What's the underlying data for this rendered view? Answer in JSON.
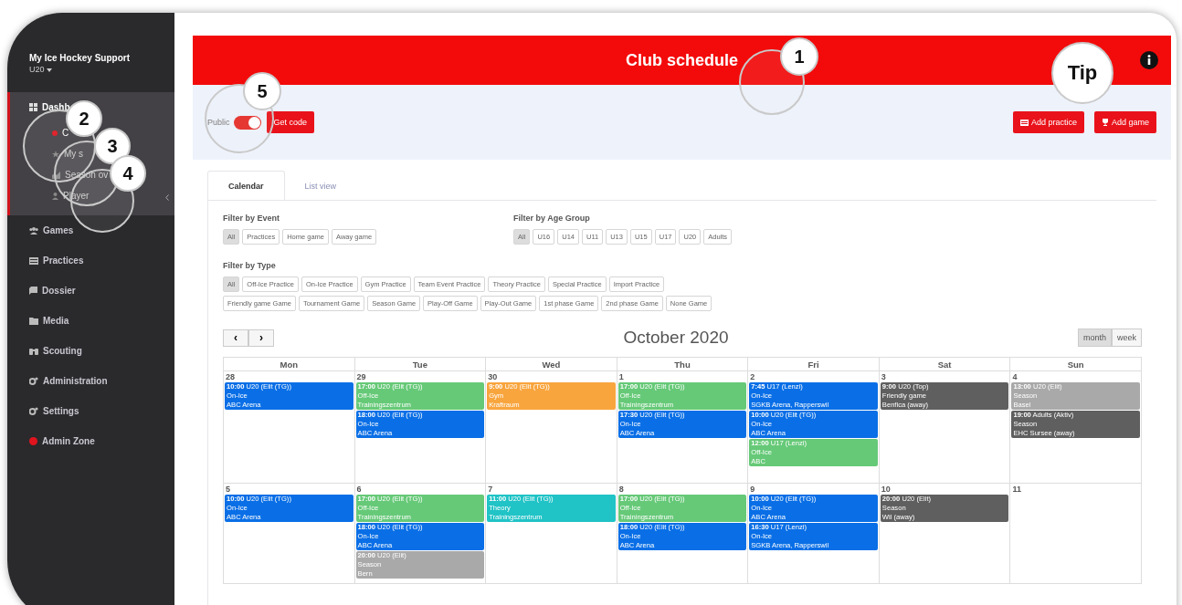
{
  "sidebar": {
    "app_name": "My Ice Hockey Support",
    "team": "U20",
    "items": [
      {
        "label": "Dashb",
        "expanded": true,
        "children": [
          {
            "label": "C",
            "selected": true
          },
          {
            "label": "My s",
            "selected": false
          },
          {
            "label": "Season ov",
            "selected": false
          },
          {
            "label": "Player",
            "selected": false
          }
        ]
      },
      {
        "label": "Games",
        "expanded": false
      },
      {
        "label": "Practices",
        "expanded": false
      },
      {
        "label": "Dossier",
        "expanded": false
      },
      {
        "label": "Media",
        "expanded": false
      },
      {
        "label": "Scouting",
        "expanded": false
      },
      {
        "label": "Administration",
        "expanded": false
      },
      {
        "label": "Settings",
        "expanded": false
      },
      {
        "label": "Admin Zone",
        "expanded": false
      }
    ]
  },
  "header": {
    "title": "Club schedule"
  },
  "toolbar": {
    "public": {
      "label": "Public",
      "on": true
    },
    "get_code": "Get code",
    "buttons": [
      "Add practice",
      "Add game"
    ]
  },
  "tabs": [
    {
      "label": "Calendar",
      "selected": true
    },
    {
      "label": "List view",
      "selected": false
    }
  ],
  "filters": [
    {
      "title": "Filter by Event",
      "rows": [
        {
          "chips": [
            {
              "label": "All",
              "selected": true
            },
            {
              "label": "Practices",
              "selected": false
            },
            {
              "label": "Home game",
              "selected": false
            },
            {
              "label": "Away game",
              "selected": false
            }
          ]
        }
      ]
    },
    {
      "title": "Filter by Age Group",
      "rows": [
        {
          "chips": [
            {
              "label": "All",
              "selected": true
            },
            {
              "label": "U16",
              "selected": false
            },
            {
              "label": "U14",
              "selected": false
            },
            {
              "label": "U11",
              "selected": false
            },
            {
              "label": "U13",
              "selected": false
            },
            {
              "label": "U15",
              "selected": false
            },
            {
              "label": "U17",
              "selected": false
            },
            {
              "label": "U20",
              "selected": false
            },
            {
              "label": "Adults",
              "selected": false
            }
          ]
        }
      ]
    },
    {
      "title": "Filter by Type",
      "rows": [
        {
          "chips": [
            {
              "label": "All",
              "selected": true
            },
            {
              "label": "Off-Ice Practice",
              "selected": false
            },
            {
              "label": "On-Ice Practice",
              "selected": false
            },
            {
              "label": "Gym Practice",
              "selected": false
            },
            {
              "label": "Team Event Practice",
              "selected": false
            },
            {
              "label": "Theory Practice",
              "selected": false
            },
            {
              "label": "Special Practice",
              "selected": false
            },
            {
              "label": "Import Practice",
              "selected": false
            }
          ]
        },
        {
          "chips": [
            {
              "label": "Friendly game Game",
              "selected": false
            },
            {
              "label": "Tournament Game",
              "selected": false
            },
            {
              "label": "Season Game",
              "selected": false
            },
            {
              "label": "Play-Off Game",
              "selected": false
            },
            {
              "label": "Play-Out Game",
              "selected": false
            },
            {
              "label": "1st phase Game",
              "selected": false
            },
            {
              "label": "2nd phase Game",
              "selected": false
            },
            {
              "label": "None Game",
              "selected": false
            }
          ]
        }
      ]
    }
  ],
  "calendar": {
    "nav": [
      "‹",
      "›"
    ],
    "title": "October 2020",
    "views": [
      {
        "label": "month",
        "selected": true
      },
      {
        "label": "week",
        "selected": false
      }
    ],
    "weekdays": [
      "Mon",
      "Tue",
      "Wed",
      "Thu",
      "Fri",
      "Sat",
      "Sun"
    ],
    "weeks": [
      {
        "days": [
          {
            "date": "28",
            "events": [
              {
                "time": "10:00",
                "group": "U20 (Elit (TG))",
                "type": "On-Ice",
                "place": "ABC Arena",
                "color": "#0a6fe6"
              }
            ]
          },
          {
            "date": "29",
            "events": [
              {
                "time": "17:00",
                "group": "U20 (Elit (TG))",
                "type": "Off-Ice",
                "place": "Trainingszentrum",
                "color": "#66c978"
              },
              {
                "time": "18:00",
                "group": "U20 (Elit (TG))",
                "type": "On-Ice",
                "place": "ABC Arena",
                "color": "#0a6fe6"
              }
            ]
          },
          {
            "date": "30",
            "events": [
              {
                "time": "9:00",
                "group": "U20 (Elit (TG))",
                "type": "Gym",
                "place": "Kraftraum",
                "color": "#f8a53e"
              }
            ]
          },
          {
            "date": "1",
            "events": [
              {
                "time": "17:00",
                "group": "U20 (Elit (TG))",
                "type": "Off-Ice",
                "place": "Trainingszentrum",
                "color": "#66c978"
              },
              {
                "time": "17:30",
                "group": "U20 (Elit (TG))",
                "type": "On-Ice",
                "place": "ABC Arena",
                "color": "#0a6fe6"
              }
            ]
          },
          {
            "date": "2",
            "events": [
              {
                "time": "7:45",
                "group": "U17 (Lenzi)",
                "type": "On-Ice",
                "place": "SGKB Arena, Rapperswil",
                "color": "#0a6fe6"
              },
              {
                "time": "10:00",
                "group": "U20 (Elit (TG))",
                "type": "On-Ice",
                "place": "ABC Arena",
                "color": "#0a6fe6"
              },
              {
                "time": "12:00",
                "group": "U17 (Lenzi)",
                "type": "Off-Ice",
                "place": "ABC",
                "color": "#66c978"
              }
            ]
          },
          {
            "date": "3",
            "events": [
              {
                "time": "9:00",
                "group": "U20 (Top)",
                "type": "Friendly game",
                "place": "Benfica (away)",
                "color": "#5f5f5f"
              }
            ]
          },
          {
            "date": "4",
            "events": [
              {
                "time": "13:00",
                "group": "U20 (Elit)",
                "type": "Season",
                "place": "Basel",
                "color": "#a9a9a9"
              },
              {
                "time": "19:00",
                "group": "Adults (Aktiv)",
                "type": "Season",
                "place": "EHC Sursee (away)",
                "color": "#5f5f5f"
              }
            ]
          }
        ]
      },
      {
        "days": [
          {
            "date": "5",
            "events": [
              {
                "time": "10:00",
                "group": "U20 (Elit (TG))",
                "type": "On-Ice",
                "place": "ABC Arena",
                "color": "#0a6fe6"
              }
            ]
          },
          {
            "date": "6",
            "events": [
              {
                "time": "17:00",
                "group": "U20 (Elit (TG))",
                "type": "Off-Ice",
                "place": "Trainingszentrum",
                "color": "#66c978"
              },
              {
                "time": "18:00",
                "group": "U20 (Elit (TG))",
                "type": "On-Ice",
                "place": "ABC Arena",
                "color": "#0a6fe6"
              },
              {
                "time": "20:00",
                "group": "U20 (Elit)",
                "type": "Season",
                "place": "Bern",
                "color": "#a9a9a9"
              }
            ]
          },
          {
            "date": "7",
            "events": [
              {
                "time": "11:00",
                "group": "U20 (Elit (TG))",
                "type": "Theory",
                "place": "Trainingszentrum",
                "color": "#20c3c6"
              }
            ]
          },
          {
            "date": "8",
            "events": [
              {
                "time": "17:00",
                "group": "U20 (Elit (TG))",
                "type": "Off-Ice",
                "place": "Trainingszentrum",
                "color": "#66c978"
              },
              {
                "time": "18:00",
                "group": "U20 (Elit (TG))",
                "type": "On-Ice",
                "place": "ABC Arena",
                "color": "#0a6fe6"
              }
            ]
          },
          {
            "date": "9",
            "events": [
              {
                "time": "10:00",
                "group": "U20 (Elit (TG))",
                "type": "On-Ice",
                "place": "ABC Arena",
                "color": "#0a6fe6"
              },
              {
                "time": "16:30",
                "group": "U17 (Lenzi)",
                "type": "On-Ice",
                "place": "SGKB Arena, Rapperswil",
                "color": "#0a6fe6"
              }
            ]
          },
          {
            "date": "10",
            "events": [
              {
                "time": "20:00",
                "group": "U20 (Elit)",
                "type": "Season",
                "place": "Wil (away)",
                "color": "#5f5f5f"
              }
            ]
          },
          {
            "date": "11"
          }
        ]
      }
    ]
  },
  "callouts": [
    {
      "label": "1"
    },
    {
      "label": "Tip"
    },
    {
      "label": "5"
    },
    {
      "label": "2"
    },
    {
      "label": "3"
    },
    {
      "label": "4"
    }
  ]
}
